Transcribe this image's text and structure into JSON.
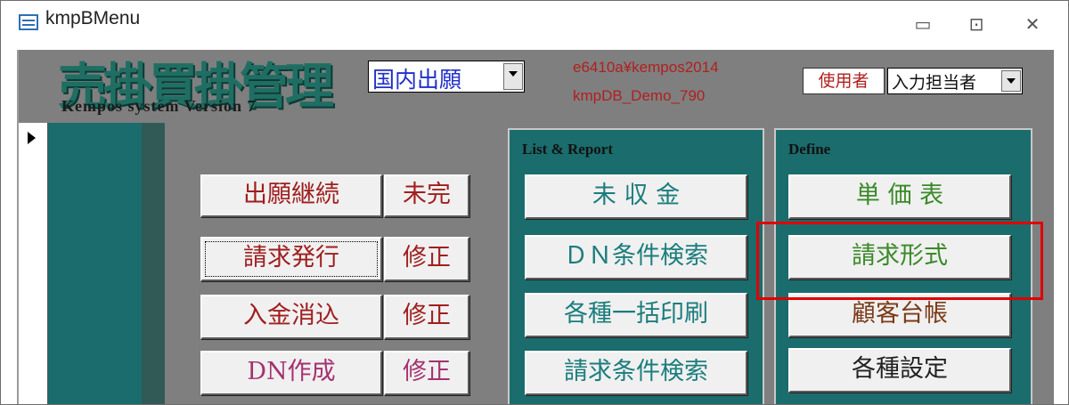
{
  "window": {
    "title": "kmpBMenu",
    "minimize_glyph": "▭",
    "maximize_glyph": "⊡",
    "close_glyph": "✕"
  },
  "header": {
    "logo_title": "売掛買掛管理",
    "logo_subtitle": "Kempos system Version 7",
    "application_type": "国内出願",
    "db_path": "e6410a¥kempos2014",
    "db_name": "kmpDB_Demo_790",
    "user_label": "使用者",
    "user_value": "入力担当者"
  },
  "left_column": [
    {
      "main": "出願継続",
      "side": "未完",
      "main_color": "#a01e1e",
      "side_color": "#a01e1e"
    },
    {
      "main": "請求発行",
      "side": "修正",
      "main_color": "#a01e1e",
      "side_color": "#a01e1e"
    },
    {
      "main": "入金消込",
      "side": "修正",
      "main_color": "#a01e1e",
      "side_color": "#a01e1e"
    },
    {
      "main": "DN作成",
      "side": "修正",
      "main_color": "#a53170",
      "side_color": "#a53170"
    }
  ],
  "list_report": {
    "title": "List & Report",
    "items": [
      "未 収 金",
      "ＤＮ条件検索",
      "各種一括印刷",
      "請求条件検索"
    ],
    "color": "#1b7d7d"
  },
  "define": {
    "title": "Define",
    "items": [
      {
        "label": "単 価 表",
        "color": "#3a8a28"
      },
      {
        "label": "請求形式",
        "color": "#3a8a28"
      },
      {
        "label": "顧客台帳",
        "color": "#7a3a16"
      },
      {
        "label": "各種設定",
        "color": "#222222"
      }
    ]
  },
  "colors": {
    "form_bg": "#7f7f7f",
    "teal": "#1b6c6c",
    "highlight": "#e00000"
  }
}
